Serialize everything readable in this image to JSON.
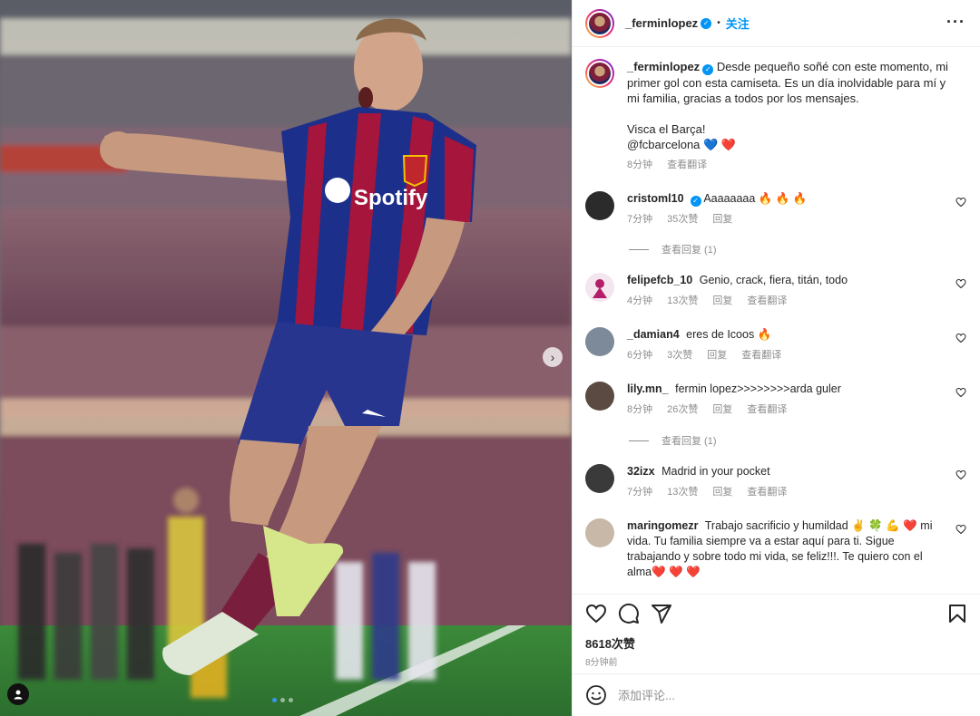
{
  "post": {
    "username": "_ferminlopez",
    "follow_label": "关注",
    "more_icon": "more-options-icon",
    "caption_paragraphs": [
      "Desde pequeño soñé con este momento, mi primer gol con esta camiseta. Es un día inolvidable para mí y mi familia, gracias a todos por los mensajes.",
      "Visca el Barça!"
    ],
    "caption_mention": "@fcbarcelona",
    "caption_emojis": "💙 ❤️",
    "caption_time": "8分钟",
    "caption_translate": "查看翻译"
  },
  "media": {
    "jersey_sponsor": "Spotify",
    "next_icon": "chevron-right-icon",
    "user_tag_icon": "person-icon",
    "carousel_count": 3,
    "carousel_active": 0
  },
  "comments": [
    {
      "username": "cristoml10",
      "verified": true,
      "text": "Aaaaaaaa 🔥 🔥 🔥",
      "time": "7分钟",
      "likes": "35次赞",
      "reply": "回复",
      "translate": "",
      "view_replies": "查看回复 (1)"
    },
    {
      "username": "felipefcb_10",
      "verified": false,
      "text": "Genio, crack, fiera, titán, todo",
      "time": "4分钟",
      "likes": "13次赞",
      "reply": "回复",
      "translate": "查看翻译",
      "view_replies": ""
    },
    {
      "username": "_damian4",
      "verified": false,
      "text": "eres de Icoos 🔥",
      "time": "6分钟",
      "likes": "3次赞",
      "reply": "回复",
      "translate": "查看翻译",
      "view_replies": ""
    },
    {
      "username": "lily.mn_",
      "verified": false,
      "text": "fermin lopez>>>>>>>>arda guler",
      "time": "8分钟",
      "likes": "26次赞",
      "reply": "回复",
      "translate": "查看翻译",
      "view_replies": "查看回复 (1)"
    },
    {
      "username": "32izx",
      "verified": false,
      "text": "Madrid in your pocket",
      "time": "7分钟",
      "likes": "13次赞",
      "reply": "回复",
      "translate": "查看翻译",
      "view_replies": ""
    },
    {
      "username": "maringomezr",
      "verified": false,
      "text": "Trabajo sacrificio y humildad ✌️ 🍀 💪 ❤️  mi vida. Tu familia siempre va a estar aquí para ti. Sigue trabajando y sobre todo mi vida, se feliz!!!. Te quiero con el alma❤️ ❤️ ❤️",
      "time": "",
      "likes": "",
      "reply": "",
      "translate": "",
      "view_replies": ""
    }
  ],
  "actions": {
    "like_icon": "heart-icon",
    "comment_icon": "comment-icon",
    "share_icon": "share-icon",
    "save_icon": "bookmark-icon",
    "likes_count": "8618次赞",
    "posted_time": "8分钟前"
  },
  "add_comment": {
    "emoji_icon": "emoji-icon",
    "placeholder": "添加评论..."
  },
  "colors": {
    "link_blue": "#0095f6",
    "verified_blue": "#0095f6",
    "muted": "#8e8e8e",
    "barca_blue": "#1c2f8a",
    "barca_red": "#a5153c"
  }
}
